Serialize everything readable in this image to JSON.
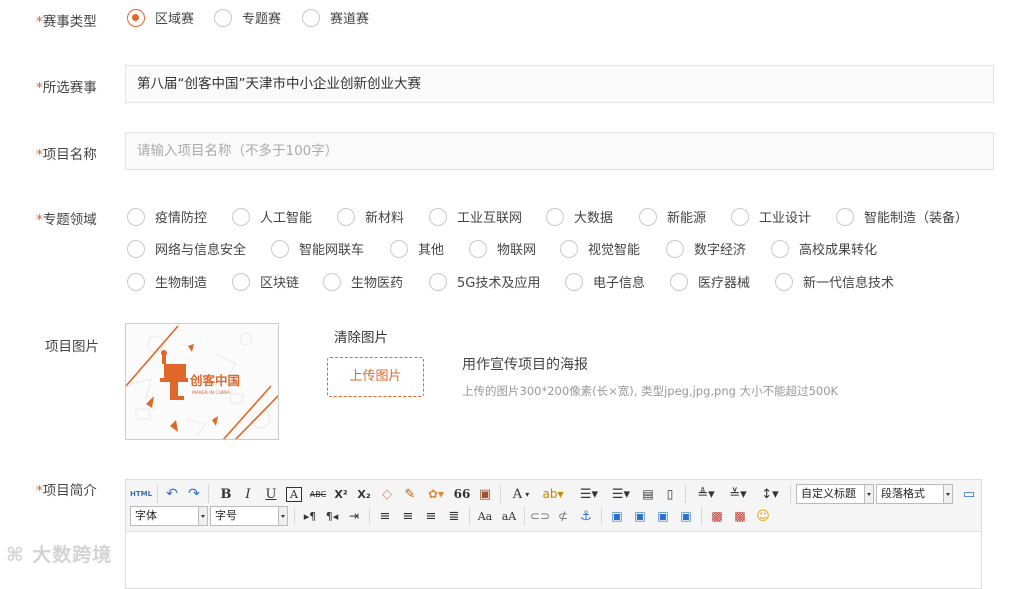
{
  "race_type": {
    "label": "赛事类型",
    "options": [
      "区域赛",
      "专题赛",
      "赛道赛"
    ],
    "selected": "区域赛"
  },
  "selected_race": {
    "label": "所选赛事",
    "value": "第八届“创客中国”天津市中小企业创新创业大赛"
  },
  "project_name": {
    "label": "项目名称",
    "placeholder": "请输入项目名称（不多于100字）"
  },
  "topic_area": {
    "label": "专题领域",
    "row1": [
      "疫情防控",
      "人工智能",
      "新材料",
      "工业互联网",
      "大数据",
      "新能源",
      "工业设计",
      "智能制造（装备）"
    ],
    "row2": [
      "网络与信息安全",
      "智能网联车",
      "其他",
      "物联网",
      "视觉智能",
      "数字经济",
      "高校成果转化"
    ],
    "row3": [
      "生物制造",
      "区块链",
      "生物医药",
      "5G技术及应用",
      "电子信息",
      "医疗器械",
      "新一代信息技术"
    ]
  },
  "project_image": {
    "label": "项目图片",
    "clear_label": "清除图片",
    "upload_label": "上传图片",
    "hint_title": "用作宣传项目的海报",
    "hint_detail": "上传的图片300*200像素(长×宽), 类型jpeg,jpg,png 大小不能超过500K",
    "poster_text": "创客中国",
    "poster_subtext": "MAKER IN CHINA"
  },
  "project_intro": {
    "label": "项目简介",
    "toolbar": {
      "html": "HTML",
      "bold": "B",
      "italic": "I",
      "underline": "U",
      "boxed_a": "A",
      "strike": "ABC",
      "superscript": "X²",
      "subscript": "X₂",
      "quote": "66",
      "font_color": "A",
      "custom_heading": "自定义标题",
      "paragraph_format": "段落格式",
      "font_family": "字体",
      "font_size": "字号"
    }
  },
  "watermark": "大数跨境",
  "colors": {
    "accent": "#e0672a",
    "required": "#e25c1f"
  }
}
